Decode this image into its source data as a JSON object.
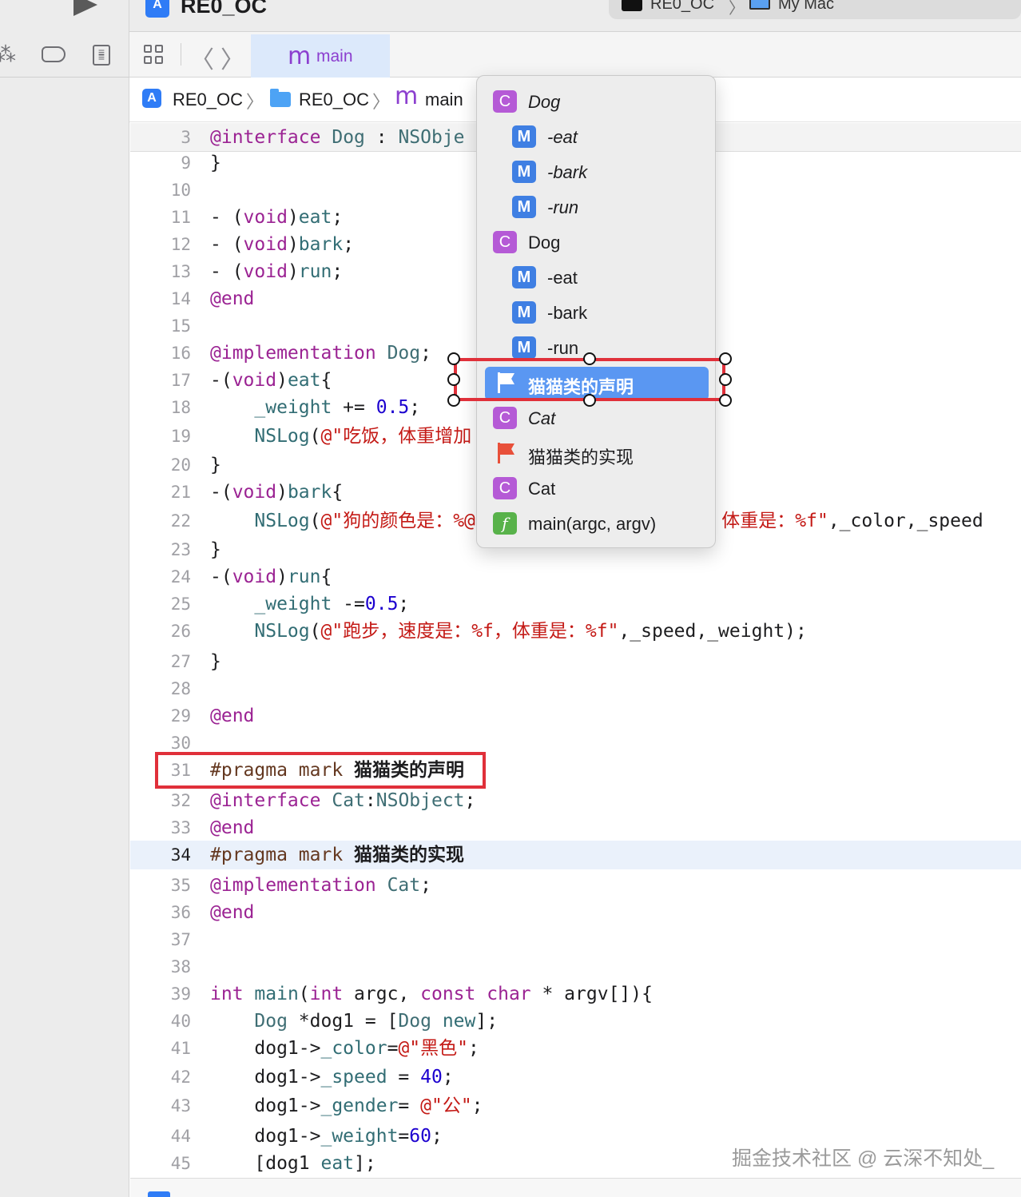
{
  "window": {
    "project_title": "RE0_OC",
    "scheme": "RE0_OC",
    "destination": "My Mac",
    "scheme_separator": "〉"
  },
  "tabbar": {
    "tab_glyph": "m",
    "tab_label": "main",
    "back_glyph": "〈",
    "forward_glyph": "〉"
  },
  "breadcrumb": {
    "project": "RE0_OC",
    "folder": "RE0_OC",
    "file_glyph": "m",
    "file": "main",
    "separator": "〉"
  },
  "symbol_menu": {
    "items": [
      {
        "kind": "class",
        "badge": "C",
        "label": "Dog"
      },
      {
        "kind": "method",
        "badge": "M",
        "label": "-eat"
      },
      {
        "kind": "method",
        "badge": "M",
        "label": "-bark"
      },
      {
        "kind": "method",
        "badge": "M",
        "label": "-run"
      },
      {
        "kind": "class",
        "badge": "C",
        "label": "Dog"
      },
      {
        "kind": "method",
        "badge": "M",
        "label": "-eat"
      },
      {
        "kind": "method",
        "badge": "M",
        "label": "-bark"
      },
      {
        "kind": "method",
        "badge": "M",
        "label": "-run"
      },
      {
        "kind": "mark",
        "badge": "",
        "label": "猫猫类的声明"
      },
      {
        "kind": "class",
        "badge": "C",
        "label": "Cat"
      },
      {
        "kind": "mark",
        "badge": "",
        "label": "猫猫类的实现"
      },
      {
        "kind": "class",
        "badge": "C",
        "label": "Cat"
      },
      {
        "kind": "function",
        "badge": "f",
        "label": "main(argc, argv)"
      }
    ],
    "selected_index": 8
  },
  "editor": {
    "current_line": 34,
    "lines": [
      {
        "n": "3",
        "parts": [
          [
            "kw",
            "@interface"
          ],
          [
            "p",
            " "
          ],
          [
            "ty2",
            "Dog"
          ],
          [
            "p",
            " : "
          ],
          [
            "ty2",
            "NSObje"
          ]
        ]
      },
      {
        "n": "9",
        "parts": [
          [
            "p",
            "}"
          ]
        ]
      },
      {
        "n": "10",
        "parts": []
      },
      {
        "n": "11",
        "parts": [
          [
            "p",
            "- ("
          ],
          [
            "kw",
            "void"
          ],
          [
            "p",
            ")"
          ],
          [
            "fn",
            "eat"
          ],
          [
            "p",
            ";"
          ]
        ]
      },
      {
        "n": "12",
        "parts": [
          [
            "p",
            "- ("
          ],
          [
            "kw",
            "void"
          ],
          [
            "p",
            ")"
          ],
          [
            "fn",
            "bark"
          ],
          [
            "p",
            ";"
          ]
        ]
      },
      {
        "n": "13",
        "parts": [
          [
            "p",
            "- ("
          ],
          [
            "kw",
            "void"
          ],
          [
            "p",
            ")"
          ],
          [
            "fn",
            "run"
          ],
          [
            "p",
            ";"
          ]
        ]
      },
      {
        "n": "14",
        "parts": [
          [
            "kw",
            "@end"
          ]
        ]
      },
      {
        "n": "15",
        "parts": []
      },
      {
        "n": "16",
        "parts": [
          [
            "kw",
            "@implementation"
          ],
          [
            "p",
            " "
          ],
          [
            "ty2",
            "Dog"
          ],
          [
            "p",
            ";"
          ]
        ]
      },
      {
        "n": "17",
        "parts": [
          [
            "p",
            "-("
          ],
          [
            "kw",
            "void"
          ],
          [
            "p",
            ")"
          ],
          [
            "fn",
            "eat"
          ],
          [
            "p",
            "{"
          ]
        ]
      },
      {
        "n": "18",
        "parts": [
          [
            "p",
            "    "
          ],
          [
            "iv",
            "_weight"
          ],
          [
            "p",
            " += "
          ],
          [
            "num",
            "0.5"
          ],
          [
            "p",
            ";"
          ]
        ]
      },
      {
        "n": "19",
        "parts": [
          [
            "p",
            "    "
          ],
          [
            "fn",
            "NSLog"
          ],
          [
            "p",
            "("
          ],
          [
            "str",
            "@\"吃饭，体重增加"
          ]
        ]
      },
      {
        "n": "20",
        "parts": [
          [
            "p",
            "}"
          ]
        ]
      },
      {
        "n": "21",
        "parts": [
          [
            "p",
            "-("
          ],
          [
            "kw",
            "void"
          ],
          [
            "p",
            ")"
          ],
          [
            "fn",
            "bark"
          ],
          [
            "p",
            "{"
          ]
        ]
      },
      {
        "n": "22",
        "parts": [
          [
            "p",
            "    "
          ],
          [
            "fn",
            "NSLog"
          ],
          [
            "p",
            "("
          ],
          [
            "str",
            "@\"狗的颜色是：%@，速度是：%f，性别是：%@，体重是：%f\""
          ],
          [
            "p",
            ",_color,_speed"
          ]
        ]
      },
      {
        "n": "23",
        "parts": [
          [
            "p",
            "}"
          ]
        ]
      },
      {
        "n": "24",
        "parts": [
          [
            "p",
            "-("
          ],
          [
            "kw",
            "void"
          ],
          [
            "p",
            ")"
          ],
          [
            "fn",
            "run"
          ],
          [
            "p",
            "{"
          ]
        ]
      },
      {
        "n": "25",
        "parts": [
          [
            "p",
            "    "
          ],
          [
            "iv",
            "_weight"
          ],
          [
            "p",
            " -="
          ],
          [
            "num",
            "0.5"
          ],
          [
            "p",
            ";"
          ]
        ]
      },
      {
        "n": "26",
        "parts": [
          [
            "p",
            "    "
          ],
          [
            "fn",
            "NSLog"
          ],
          [
            "p",
            "("
          ],
          [
            "str",
            "@\"跑步，速度是：%f，体重是：%f\""
          ],
          [
            "p",
            ",_speed,_weight);"
          ]
        ]
      },
      {
        "n": "27",
        "parts": [
          [
            "p",
            "}"
          ]
        ]
      },
      {
        "n": "28",
        "parts": []
      },
      {
        "n": "29",
        "parts": [
          [
            "kw",
            "@end"
          ]
        ]
      },
      {
        "n": "30",
        "parts": []
      },
      {
        "n": "31",
        "parts": [
          [
            "pm",
            "#pragma mark "
          ],
          [
            "pmt",
            "猫猫类的声明"
          ]
        ]
      },
      {
        "n": "32",
        "parts": [
          [
            "kw",
            "@interface"
          ],
          [
            "p",
            " "
          ],
          [
            "ty2",
            "Cat"
          ],
          [
            "p",
            ":"
          ],
          [
            "ty2",
            "NSObject"
          ],
          [
            "p",
            ";"
          ]
        ]
      },
      {
        "n": "33",
        "parts": [
          [
            "kw",
            "@end"
          ]
        ]
      },
      {
        "n": "34",
        "parts": [
          [
            "pm",
            "#pragma mark "
          ],
          [
            "pmt",
            "猫猫类的实现"
          ]
        ]
      },
      {
        "n": "35",
        "parts": [
          [
            "kw",
            "@implementation"
          ],
          [
            "p",
            " "
          ],
          [
            "ty2",
            "Cat"
          ],
          [
            "p",
            ";"
          ]
        ]
      },
      {
        "n": "36",
        "parts": [
          [
            "kw",
            "@end"
          ]
        ]
      },
      {
        "n": "37",
        "parts": []
      },
      {
        "n": "38",
        "parts": []
      },
      {
        "n": "39",
        "parts": [
          [
            "kw",
            "int"
          ],
          [
            "p",
            " "
          ],
          [
            "fn",
            "main"
          ],
          [
            "p",
            "("
          ],
          [
            "kw",
            "int"
          ],
          [
            "p",
            " argc, "
          ],
          [
            "kw",
            "const"
          ],
          [
            "p",
            " "
          ],
          [
            "kw",
            "char"
          ],
          [
            "p",
            " * argv[]){"
          ]
        ]
      },
      {
        "n": "40",
        "parts": [
          [
            "p",
            "    "
          ],
          [
            "ty2",
            "Dog"
          ],
          [
            "p",
            " *dog1 = ["
          ],
          [
            "ty2",
            "Dog"
          ],
          [
            "p",
            " "
          ],
          [
            "fn",
            "new"
          ],
          [
            "p",
            "];"
          ]
        ]
      },
      {
        "n": "41",
        "parts": [
          [
            "p",
            "    dog1->"
          ],
          [
            "iv",
            "_color"
          ],
          [
            "p",
            "="
          ],
          [
            "str",
            "@\"黑色\""
          ],
          [
            "p",
            ";"
          ]
        ]
      },
      {
        "n": "42",
        "parts": [
          [
            "p",
            "    dog1->"
          ],
          [
            "iv",
            "_speed"
          ],
          [
            "p",
            " = "
          ],
          [
            "num",
            "40"
          ],
          [
            "p",
            ";"
          ]
        ]
      },
      {
        "n": "43",
        "parts": [
          [
            "p",
            "    dog1->"
          ],
          [
            "iv",
            "_gender"
          ],
          [
            "p",
            "= "
          ],
          [
            "str",
            "@\"公\""
          ],
          [
            "p",
            ";"
          ]
        ]
      },
      {
        "n": "44",
        "parts": [
          [
            "p",
            "    dog1->"
          ],
          [
            "iv",
            "_weight"
          ],
          [
            "p",
            "="
          ],
          [
            "num",
            "60"
          ],
          [
            "p",
            ";"
          ]
        ]
      },
      {
        "n": "45",
        "parts": [
          [
            "p",
            "    [dog1 "
          ],
          [
            "fn",
            "eat"
          ],
          [
            "p",
            "];"
          ]
        ]
      }
    ]
  },
  "watermark": "掘金技术社区 @ 云深不知处_",
  "colors": {
    "keyword": "#9b2393",
    "string": "#c41a16",
    "number": "#1c00cf",
    "type": "#3f6e74",
    "selection": "#5a97f2",
    "annotation_red": "#e0303a"
  }
}
